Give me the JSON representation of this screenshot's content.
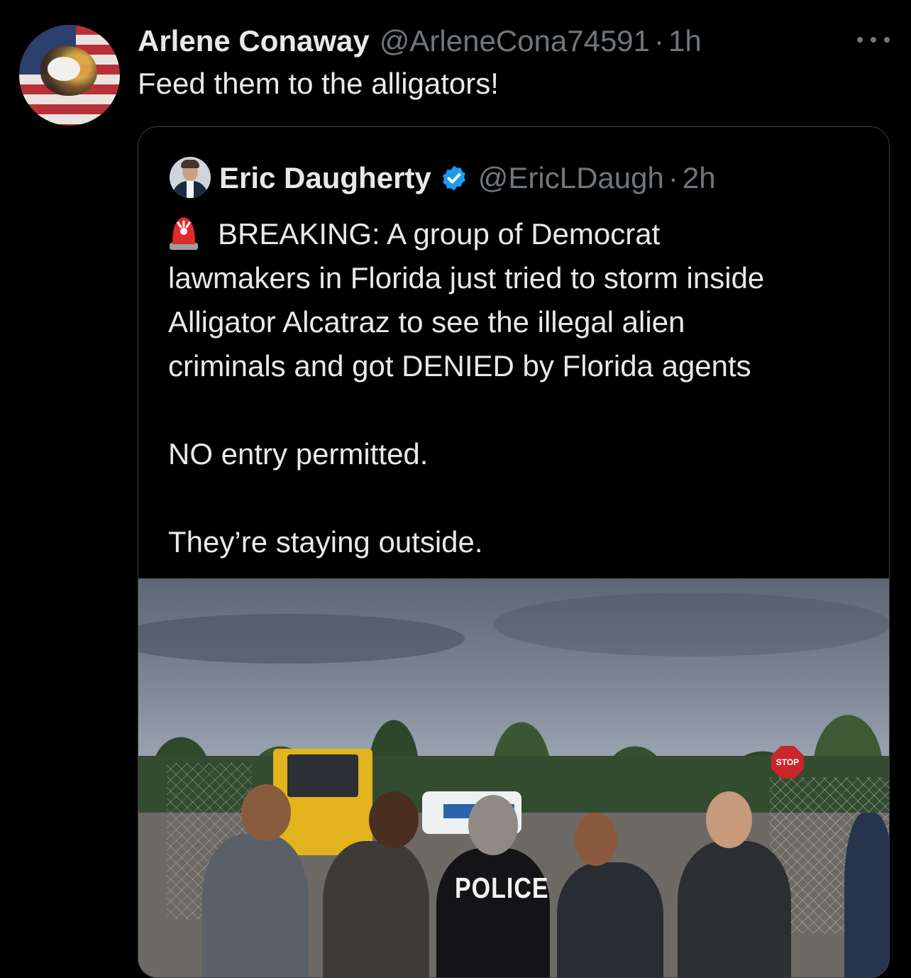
{
  "tweet": {
    "author_name": "Arlene Conaway",
    "handle": "@ArleneCona74591",
    "separator": "·",
    "time": "1h",
    "text": "Feed them to the alligators!"
  },
  "quoted_tweet": {
    "author_name": "Eric Daugherty",
    "handle": "@EricLDaugh",
    "separator": "·",
    "time": "2h",
    "verified_color": "#1d9bf0",
    "lines": [
      "BREAKING: A group of Democrat",
      "lawmakers in Florida just tried to storm inside",
      "Alligator Alcatraz to see the illegal alien",
      "criminals and got DENIED by Florida agents"
    ],
    "line_no_entry": "NO entry permitted.",
    "line_outside": "They’re staying outside.",
    "photo": {
      "stop_sign": "STOP",
      "police_text": "POLICE"
    }
  },
  "icons": {
    "more": "more-horizontal-icon",
    "siren": "police-siren-emoji-icon",
    "verified": "verified-badge-icon"
  }
}
